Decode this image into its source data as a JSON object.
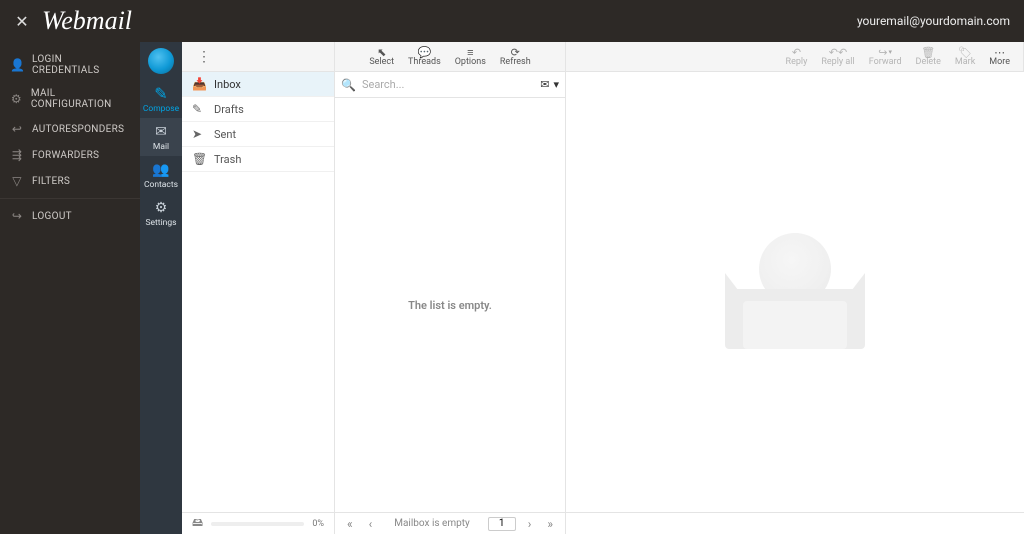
{
  "header": {
    "brand": "Webmail",
    "user_email": "youremail@yourdomain.com"
  },
  "cp_sidebar": {
    "items": [
      {
        "icon": "👤",
        "label": "LOGIN CREDENTIALS"
      },
      {
        "icon": "⚙",
        "label": "MAIL CONFIGURATION"
      },
      {
        "icon": "↩",
        "label": "AUTORESPONDERS"
      },
      {
        "icon": "⇶",
        "label": "FORWARDERS"
      },
      {
        "icon": "▽",
        "label": "FILTERS"
      },
      {
        "icon": "↪",
        "label": "LOGOUT"
      }
    ]
  },
  "app_sidebar": {
    "items": [
      {
        "key": "compose",
        "glyph": "✎",
        "label": "Compose"
      },
      {
        "key": "mail",
        "glyph": "✉",
        "label": "Mail"
      },
      {
        "key": "contacts",
        "glyph": "👥",
        "label": "Contacts"
      },
      {
        "key": "settings",
        "glyph": "⚙",
        "label": "Settings"
      }
    ],
    "active": "mail"
  },
  "toolbar": {
    "list": [
      {
        "key": "select",
        "glyph": "⬉",
        "label": "Select"
      },
      {
        "key": "threads",
        "glyph": "💬",
        "label": "Threads"
      },
      {
        "key": "options",
        "glyph": "≡",
        "label": "Options"
      },
      {
        "key": "refresh",
        "glyph": "⟳",
        "label": "Refresh"
      }
    ],
    "message": [
      {
        "key": "reply",
        "glyph": "↶",
        "label": "Reply"
      },
      {
        "key": "replyall",
        "glyph": "↶↶",
        "label": "Reply all"
      },
      {
        "key": "forward",
        "glyph": "↪",
        "label": "Forward"
      },
      {
        "key": "delete",
        "glyph": "🗑",
        "label": "Delete"
      },
      {
        "key": "mark",
        "glyph": "🏷",
        "label": "Mark"
      },
      {
        "key": "more",
        "glyph": "⋯",
        "label": "More"
      }
    ]
  },
  "folders": [
    {
      "key": "inbox",
      "icon": "📥",
      "label": "Inbox",
      "active": true
    },
    {
      "key": "drafts",
      "icon": "✎",
      "label": "Drafts"
    },
    {
      "key": "sent",
      "icon": "➤",
      "label": "Sent"
    },
    {
      "key": "trash",
      "icon": "🗑",
      "label": "Trash"
    }
  ],
  "search": {
    "placeholder": "Search..."
  },
  "list": {
    "empty_text": "The list is empty."
  },
  "footer": {
    "quota_percent": "0%",
    "pager_text": "Mailbox is empty",
    "page_input": "1"
  }
}
